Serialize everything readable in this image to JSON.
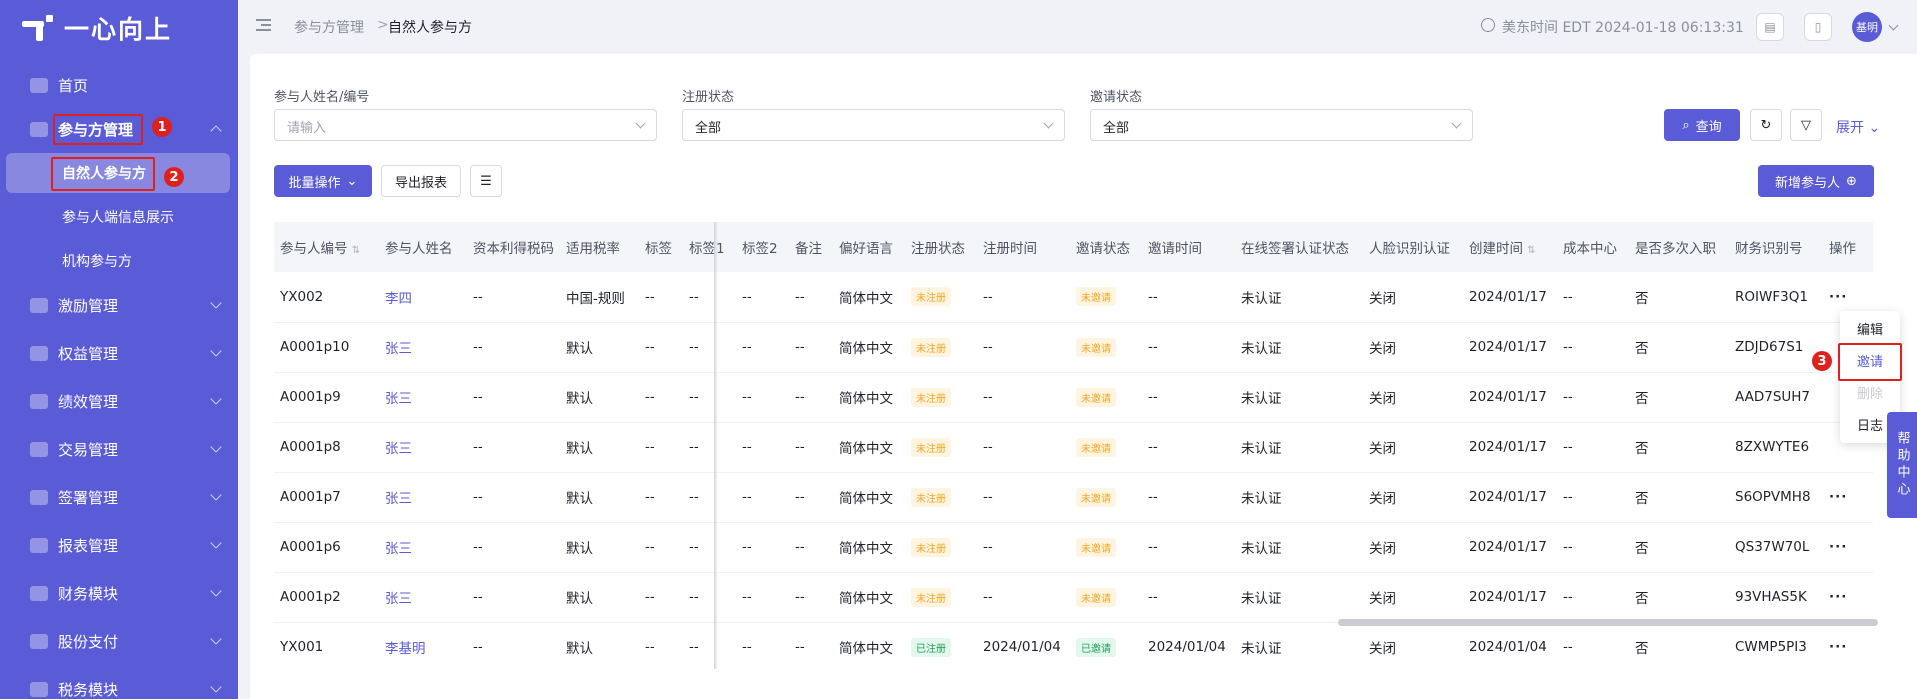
{
  "app": {
    "name": "一心向上"
  },
  "sidebar": {
    "items": [
      {
        "label": "首页"
      },
      {
        "label": "参与方管理"
      },
      {
        "label": "激励管理"
      },
      {
        "label": "权益管理"
      },
      {
        "label": "绩效管理"
      },
      {
        "label": "交易管理"
      },
      {
        "label": "签署管理"
      },
      {
        "label": "报表管理"
      },
      {
        "label": "财务模块"
      },
      {
        "label": "股份支付"
      },
      {
        "label": "税务模块"
      }
    ],
    "sub_items": [
      {
        "label": "自然人参与方"
      },
      {
        "label": "参与人端信息展示"
      },
      {
        "label": "机构参与方"
      }
    ]
  },
  "header": {
    "breadcrumb": [
      "参与方管理",
      "自然人参与方"
    ],
    "time": "美东时间 EDT 2024-01-18 06:13:31",
    "avatar": "基明"
  },
  "filters": {
    "name_label": "参与人姓名/编号",
    "name_placeholder": "请输入",
    "reg_label": "注册状态",
    "reg_value": "全部",
    "invite_label": "邀请状态",
    "invite_value": "全部",
    "query": "查询",
    "expand": "展开"
  },
  "toolbar": {
    "batch": "批量操作",
    "export": "导出报表",
    "add": "新增参与人"
  },
  "table": {
    "columns": [
      "参与人编号",
      "参与人姓名",
      "资本利得税码",
      "适用税率",
      "标签",
      "标签1",
      "标签2",
      "备注",
      "偏好语言",
      "注册状态",
      "注册时间",
      "邀请状态",
      "邀请时间",
      "在线签署认证状态",
      "人脸识别认证",
      "创建时间",
      "成本中心",
      "是否多次入职",
      "财务识别号",
      "操作"
    ],
    "rows": [
      {
        "id": "YX002",
        "name": "李四",
        "tax": "--",
        "rate": "中国-规则",
        "t": "--",
        "t1": "--",
        "t2": "--",
        "note": "--",
        "lang": "简体中文",
        "reg": "未注册",
        "reg_time": "--",
        "inv": "未邀请",
        "inv_time": "--",
        "sign": "未认证",
        "face": "关闭",
        "created": "2024/01/17",
        "cost": "--",
        "multi": "否",
        "fin": "ROIWF3Q1",
        "op": "···"
      },
      {
        "id": "A0001p10",
        "name": "张三",
        "tax": "--",
        "rate": "默认",
        "t": "--",
        "t1": "--",
        "t2": "--",
        "note": "--",
        "lang": "简体中文",
        "reg": "未注册",
        "reg_time": "--",
        "inv": "未邀请",
        "inv_time": "--",
        "sign": "未认证",
        "face": "关闭",
        "created": "2024/01/17",
        "cost": "--",
        "multi": "否",
        "fin": "ZDJD67S1",
        "op": ""
      },
      {
        "id": "A0001p9",
        "name": "张三",
        "tax": "--",
        "rate": "默认",
        "t": "--",
        "t1": "--",
        "t2": "--",
        "note": "--",
        "lang": "简体中文",
        "reg": "未注册",
        "reg_time": "--",
        "inv": "未邀请",
        "inv_time": "--",
        "sign": "未认证",
        "face": "关闭",
        "created": "2024/01/17",
        "cost": "--",
        "multi": "否",
        "fin": "AAD7SUH7",
        "op": ""
      },
      {
        "id": "A0001p8",
        "name": "张三",
        "tax": "--",
        "rate": "默认",
        "t": "--",
        "t1": "--",
        "t2": "--",
        "note": "--",
        "lang": "简体中文",
        "reg": "未注册",
        "reg_time": "--",
        "inv": "未邀请",
        "inv_time": "--",
        "sign": "未认证",
        "face": "关闭",
        "created": "2024/01/17",
        "cost": "--",
        "multi": "否",
        "fin": "8ZXWYTE6",
        "op": ""
      },
      {
        "id": "A0001p7",
        "name": "张三",
        "tax": "--",
        "rate": "默认",
        "t": "--",
        "t1": "--",
        "t2": "--",
        "note": "--",
        "lang": "简体中文",
        "reg": "未注册",
        "reg_time": "--",
        "inv": "未邀请",
        "inv_time": "--",
        "sign": "未认证",
        "face": "关闭",
        "created": "2024/01/17",
        "cost": "--",
        "multi": "否",
        "fin": "S6OPVMH8",
        "op": "···"
      },
      {
        "id": "A0001p6",
        "name": "张三",
        "tax": "--",
        "rate": "默认",
        "t": "--",
        "t1": "--",
        "t2": "--",
        "note": "--",
        "lang": "简体中文",
        "reg": "未注册",
        "reg_time": "--",
        "inv": "未邀请",
        "inv_time": "--",
        "sign": "未认证",
        "face": "关闭",
        "created": "2024/01/17",
        "cost": "--",
        "multi": "否",
        "fin": "QS37W70L",
        "op": "···"
      },
      {
        "id": "A0001p2",
        "name": "张三",
        "tax": "--",
        "rate": "默认",
        "t": "--",
        "t1": "--",
        "t2": "--",
        "note": "--",
        "lang": "简体中文",
        "reg": "未注册",
        "reg_time": "--",
        "inv": "未邀请",
        "inv_time": "--",
        "sign": "未认证",
        "face": "关闭",
        "created": "2024/01/17",
        "cost": "--",
        "multi": "否",
        "fin": "93VHAS5K",
        "op": "···"
      },
      {
        "id": "YX001",
        "name": "李基明",
        "tax": "--",
        "rate": "默认",
        "t": "--",
        "t1": "--",
        "t2": "--",
        "note": "--",
        "lang": "简体中文",
        "reg": "已注册",
        "reg_time": "2024/01/04",
        "inv": "已邀请",
        "inv_time": "2024/01/04",
        "sign": "未认证",
        "face": "关闭",
        "created": "2024/01/04",
        "cost": "--",
        "multi": "否",
        "fin": "CWMP5PI3",
        "op": "···"
      }
    ]
  },
  "menu": {
    "edit": "编辑",
    "invite": "邀请",
    "delete": "删除",
    "log": "日志"
  },
  "help": "帮助中心",
  "annotations": [
    "1",
    "2",
    "3"
  ],
  "colors": {
    "primary": "#5a5bd6",
    "annotation": "#e0201c"
  }
}
